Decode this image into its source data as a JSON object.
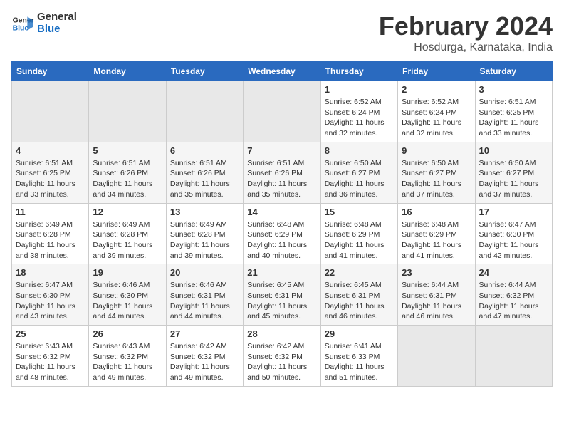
{
  "logo": {
    "line1": "General",
    "line2": "Blue"
  },
  "title": "February 2024",
  "subtitle": "Hosdurga, Karnataka, India",
  "headers": [
    "Sunday",
    "Monday",
    "Tuesday",
    "Wednesday",
    "Thursday",
    "Friday",
    "Saturday"
  ],
  "weeks": [
    [
      {
        "day": "",
        "info": ""
      },
      {
        "day": "",
        "info": ""
      },
      {
        "day": "",
        "info": ""
      },
      {
        "day": "",
        "info": ""
      },
      {
        "day": "1",
        "info": "Sunrise: 6:52 AM\nSunset: 6:24 PM\nDaylight: 11 hours and 32 minutes."
      },
      {
        "day": "2",
        "info": "Sunrise: 6:52 AM\nSunset: 6:24 PM\nDaylight: 11 hours and 32 minutes."
      },
      {
        "day": "3",
        "info": "Sunrise: 6:51 AM\nSunset: 6:25 PM\nDaylight: 11 hours and 33 minutes."
      }
    ],
    [
      {
        "day": "4",
        "info": "Sunrise: 6:51 AM\nSunset: 6:25 PM\nDaylight: 11 hours and 33 minutes."
      },
      {
        "day": "5",
        "info": "Sunrise: 6:51 AM\nSunset: 6:26 PM\nDaylight: 11 hours and 34 minutes."
      },
      {
        "day": "6",
        "info": "Sunrise: 6:51 AM\nSunset: 6:26 PM\nDaylight: 11 hours and 35 minutes."
      },
      {
        "day": "7",
        "info": "Sunrise: 6:51 AM\nSunset: 6:26 PM\nDaylight: 11 hours and 35 minutes."
      },
      {
        "day": "8",
        "info": "Sunrise: 6:50 AM\nSunset: 6:27 PM\nDaylight: 11 hours and 36 minutes."
      },
      {
        "day": "9",
        "info": "Sunrise: 6:50 AM\nSunset: 6:27 PM\nDaylight: 11 hours and 37 minutes."
      },
      {
        "day": "10",
        "info": "Sunrise: 6:50 AM\nSunset: 6:27 PM\nDaylight: 11 hours and 37 minutes."
      }
    ],
    [
      {
        "day": "11",
        "info": "Sunrise: 6:49 AM\nSunset: 6:28 PM\nDaylight: 11 hours and 38 minutes."
      },
      {
        "day": "12",
        "info": "Sunrise: 6:49 AM\nSunset: 6:28 PM\nDaylight: 11 hours and 39 minutes."
      },
      {
        "day": "13",
        "info": "Sunrise: 6:49 AM\nSunset: 6:28 PM\nDaylight: 11 hours and 39 minutes."
      },
      {
        "day": "14",
        "info": "Sunrise: 6:48 AM\nSunset: 6:29 PM\nDaylight: 11 hours and 40 minutes."
      },
      {
        "day": "15",
        "info": "Sunrise: 6:48 AM\nSunset: 6:29 PM\nDaylight: 11 hours and 41 minutes."
      },
      {
        "day": "16",
        "info": "Sunrise: 6:48 AM\nSunset: 6:29 PM\nDaylight: 11 hours and 41 minutes."
      },
      {
        "day": "17",
        "info": "Sunrise: 6:47 AM\nSunset: 6:30 PM\nDaylight: 11 hours and 42 minutes."
      }
    ],
    [
      {
        "day": "18",
        "info": "Sunrise: 6:47 AM\nSunset: 6:30 PM\nDaylight: 11 hours and 43 minutes."
      },
      {
        "day": "19",
        "info": "Sunrise: 6:46 AM\nSunset: 6:30 PM\nDaylight: 11 hours and 44 minutes."
      },
      {
        "day": "20",
        "info": "Sunrise: 6:46 AM\nSunset: 6:31 PM\nDaylight: 11 hours and 44 minutes."
      },
      {
        "day": "21",
        "info": "Sunrise: 6:45 AM\nSunset: 6:31 PM\nDaylight: 11 hours and 45 minutes."
      },
      {
        "day": "22",
        "info": "Sunrise: 6:45 AM\nSunset: 6:31 PM\nDaylight: 11 hours and 46 minutes."
      },
      {
        "day": "23",
        "info": "Sunrise: 6:44 AM\nSunset: 6:31 PM\nDaylight: 11 hours and 46 minutes."
      },
      {
        "day": "24",
        "info": "Sunrise: 6:44 AM\nSunset: 6:32 PM\nDaylight: 11 hours and 47 minutes."
      }
    ],
    [
      {
        "day": "25",
        "info": "Sunrise: 6:43 AM\nSunset: 6:32 PM\nDaylight: 11 hours and 48 minutes."
      },
      {
        "day": "26",
        "info": "Sunrise: 6:43 AM\nSunset: 6:32 PM\nDaylight: 11 hours and 49 minutes."
      },
      {
        "day": "27",
        "info": "Sunrise: 6:42 AM\nSunset: 6:32 PM\nDaylight: 11 hours and 49 minutes."
      },
      {
        "day": "28",
        "info": "Sunrise: 6:42 AM\nSunset: 6:32 PM\nDaylight: 11 hours and 50 minutes."
      },
      {
        "day": "29",
        "info": "Sunrise: 6:41 AM\nSunset: 6:33 PM\nDaylight: 11 hours and 51 minutes."
      },
      {
        "day": "",
        "info": ""
      },
      {
        "day": "",
        "info": ""
      }
    ]
  ]
}
